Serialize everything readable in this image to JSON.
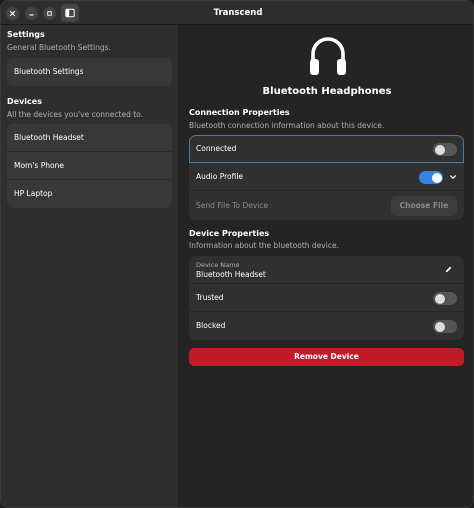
{
  "window": {
    "title": "Transcend"
  },
  "headerbar": {
    "close_icon": "close-icon",
    "minimize_icon": "minimize-icon",
    "maximize_icon": "maximize-icon",
    "sidebar_toggle_icon": "sidebar-toggle-icon"
  },
  "sidebar": {
    "settings_title": "Settings",
    "settings_subtitle": "General Bluetooth Settings.",
    "settings_item": "Bluetooth Settings",
    "devices_title": "Devices",
    "devices_subtitle": "All the devices you've connected to.",
    "devices": [
      {
        "label": "Bluetooth Headset"
      },
      {
        "label": "Mom's Phone"
      },
      {
        "label": "HP Laptop"
      }
    ]
  },
  "main": {
    "device_icon": "headphones-icon",
    "device_title": "Bluetooth Headphones",
    "connection": {
      "title": "Connection Properties",
      "subtitle": "Bluetooth connection information about this device.",
      "connected_label": "Connected",
      "connected": false,
      "audio_profile_label": "Audio Profile",
      "audio_profile": true,
      "send_file_label": "Send File To Device",
      "choose_file_label": "Choose File"
    },
    "device_props": {
      "title": "Device Properties",
      "subtitle": "Information about the bluetooth device.",
      "name_label": "Device Name",
      "name_value": "Bluetooth Headset",
      "trusted_label": "Trusted",
      "trusted": false,
      "blocked_label": "Blocked",
      "blocked": false
    },
    "remove_label": "Remove Device"
  },
  "colors": {
    "accent": "#3584e4",
    "destructive": "#c01c28"
  }
}
